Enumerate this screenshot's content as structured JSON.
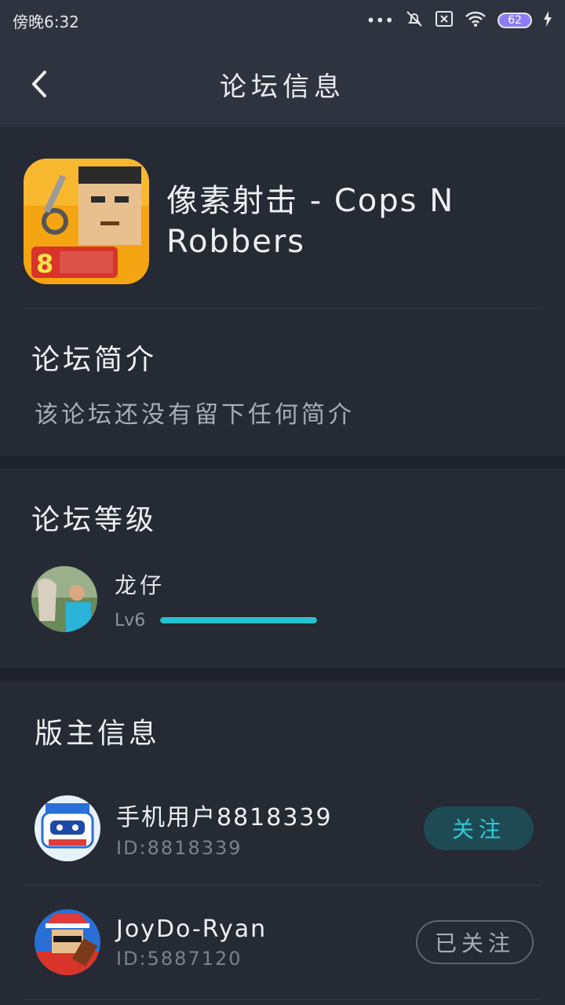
{
  "status_bar": {
    "time": "傍晚6:32",
    "battery": "62",
    "icons": [
      "more-dots-icon",
      "mute-bell-icon",
      "close-box-icon",
      "wifi-icon",
      "battery-icon",
      "charging-icon"
    ]
  },
  "header": {
    "title": "论坛信息"
  },
  "forum": {
    "name": "像素射击 - Cops N Robbers"
  },
  "intro": {
    "title": "论坛简介",
    "text": "该论坛还没有留下任何简介"
  },
  "level": {
    "title": "论坛等级",
    "user_name": "龙仔",
    "level_label": "Lv6",
    "progress": 1.0
  },
  "moderators": {
    "title": "版主信息",
    "items": [
      {
        "name": "手机用户8818339",
        "id": "ID:8818339",
        "button": "关注",
        "followed": false
      },
      {
        "name": "JoyDo-Ryan",
        "id": "ID:5887120",
        "button": "已关注",
        "followed": true
      }
    ]
  },
  "colors": {
    "accent": "#27c2cf",
    "background": "#262a35",
    "bar": "#2e333f"
  }
}
